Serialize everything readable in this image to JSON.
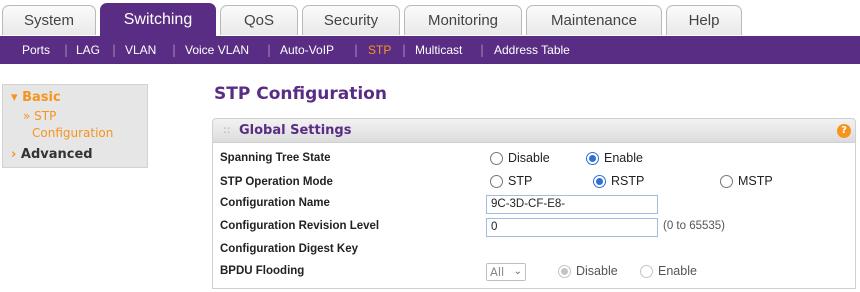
{
  "tabs": [
    {
      "label": "System"
    },
    {
      "label": "Switching"
    },
    {
      "label": "QoS"
    },
    {
      "label": "Security"
    },
    {
      "label": "Monitoring"
    },
    {
      "label": "Maintenance"
    },
    {
      "label": "Help"
    }
  ],
  "submenu": [
    {
      "label": "Ports"
    },
    {
      "label": "LAG"
    },
    {
      "label": "VLAN"
    },
    {
      "label": "Voice VLAN"
    },
    {
      "label": "Auto-VoIP"
    },
    {
      "label": "STP"
    },
    {
      "label": "Multicast"
    },
    {
      "label": "Address Table"
    }
  ],
  "nav": {
    "basic_label": "Basic",
    "basic_arrow": "▾",
    "stp_arrow": "»",
    "stp_line1": "STP",
    "stp_line2": "Configuration",
    "advanced_arrow": "›",
    "advanced_label": "Advanced"
  },
  "main": {
    "page_title": "STP Configuration",
    "section_title": "Global Settings",
    "section_grip": "::",
    "help_glyph": "?"
  },
  "form": {
    "spanning_tree_state": {
      "label": "Spanning Tree State",
      "options": [
        "Disable",
        "Enable"
      ],
      "selected": "Enable"
    },
    "stp_operation_mode": {
      "label": "STP Operation Mode",
      "options": [
        "STP",
        "RSTP",
        "MSTP"
      ],
      "selected": "RSTP"
    },
    "configuration_name": {
      "label": "Configuration Name",
      "value": "9C-3D-CF-E8-"
    },
    "configuration_revision_level": {
      "label": "Configuration Revision Level",
      "value": "0",
      "hint": "(0 to 65535)"
    },
    "configuration_digest_key": {
      "label": "Configuration Digest Key"
    },
    "bpdu_flooding": {
      "label": "BPDU Flooding",
      "scope_value": "All",
      "chevron": "⌄",
      "options": [
        "Disable",
        "Enable"
      ],
      "selected": "Disable",
      "disabled": true
    }
  },
  "colors": {
    "brand_purple": "#5a2d84",
    "accent_orange": "#f7941e",
    "radio_blue": "#2f6fd0"
  },
  "separator": "|"
}
